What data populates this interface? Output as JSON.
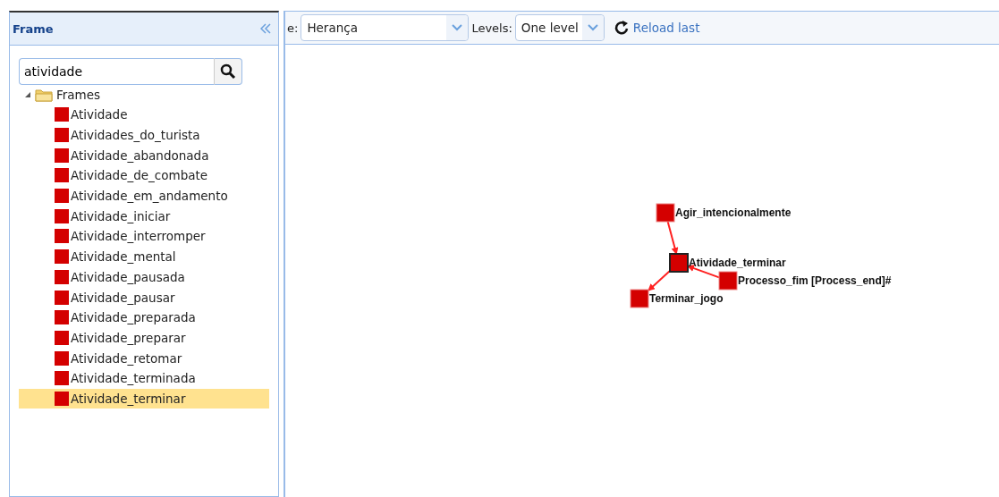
{
  "panel": {
    "title": "Frame",
    "search": {
      "value": "atividade"
    },
    "tree": {
      "label": "Frames",
      "expanded": true,
      "children": [
        {
          "label": "Atividade",
          "selected": false
        },
        {
          "label": "Atividades_do_turista",
          "selected": false
        },
        {
          "label": "Atividade_abandonada",
          "selected": false
        },
        {
          "label": "Atividade_de_combate",
          "selected": false
        },
        {
          "label": "Atividade_em_andamento",
          "selected": false
        },
        {
          "label": "Atividade_iniciar",
          "selected": false
        },
        {
          "label": "Atividade_interromper",
          "selected": false
        },
        {
          "label": "Atividade_mental",
          "selected": false
        },
        {
          "label": "Atividade_pausada",
          "selected": false
        },
        {
          "label": "Atividade_pausar",
          "selected": false
        },
        {
          "label": "Atividade_preparada",
          "selected": false
        },
        {
          "label": "Atividade_preparar",
          "selected": false
        },
        {
          "label": "Atividade_retomar",
          "selected": false
        },
        {
          "label": "Atividade_terminada",
          "selected": false
        },
        {
          "label": "Atividade_terminar",
          "selected": true
        }
      ]
    }
  },
  "toolbar": {
    "relation_label": "e:",
    "relation": "Herança",
    "levels_label": "Levels:",
    "levels": "One level",
    "reload": "Reload last"
  },
  "graph": {
    "nodes": [
      {
        "label": "Agir_intencionalmente",
        "kind": "parent"
      },
      {
        "label": "Atividade_terminar",
        "kind": "focus"
      },
      {
        "label": "Processo_fim [Process_end]#",
        "kind": "parent"
      },
      {
        "label": "Terminar_jogo",
        "kind": "child"
      }
    ]
  }
}
